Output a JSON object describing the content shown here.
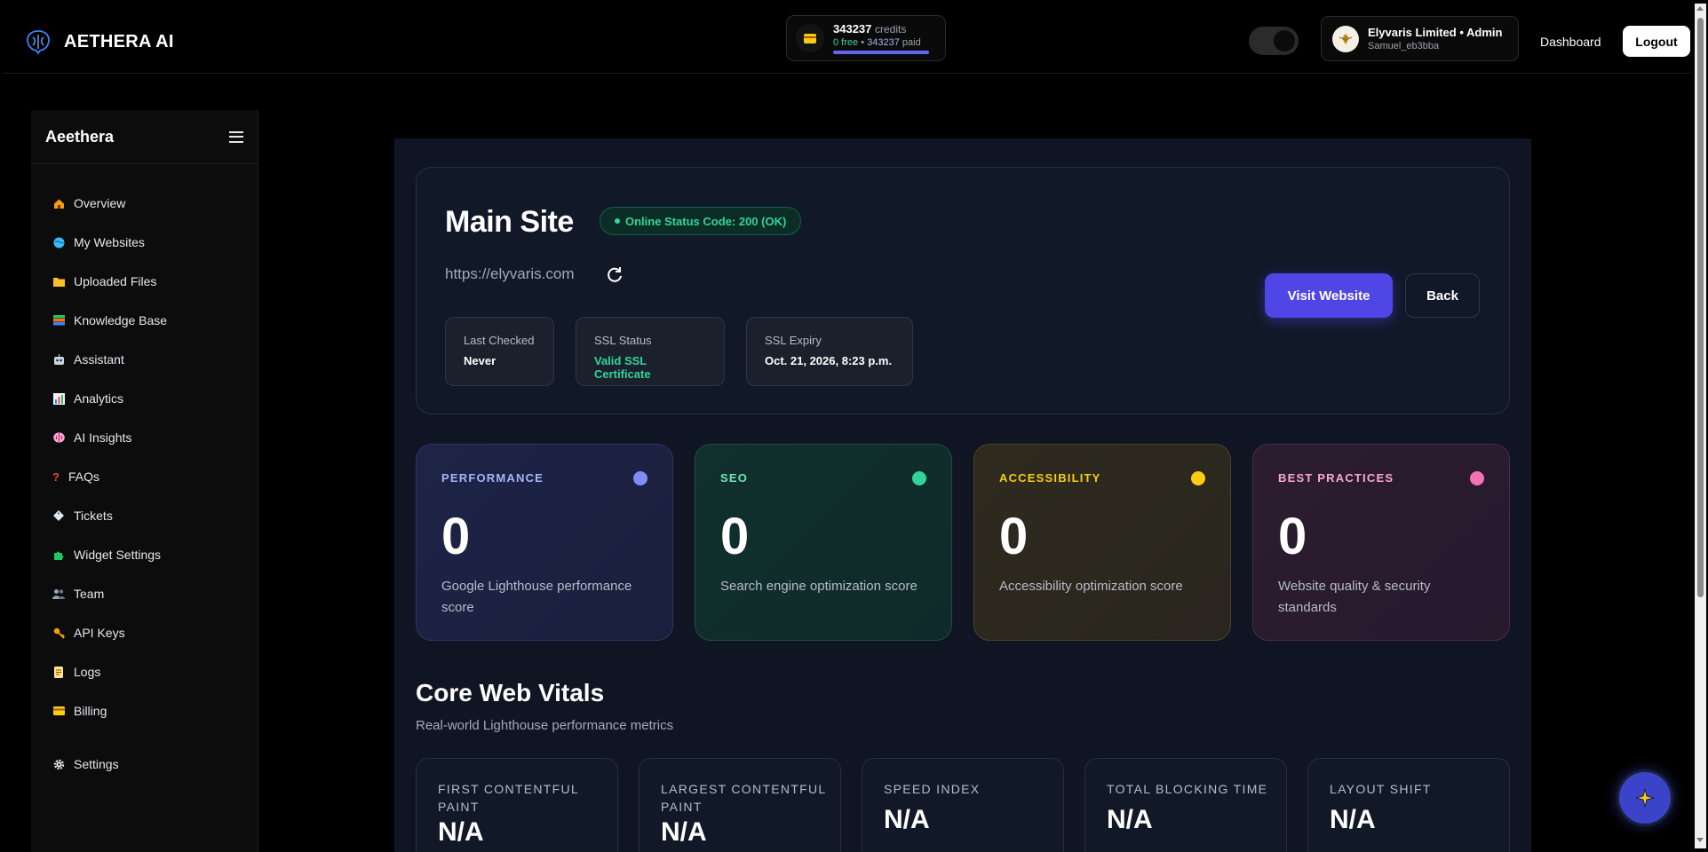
{
  "brand": {
    "name": "AETHERA AI"
  },
  "credits": {
    "total": "343237",
    "total_label": "credits",
    "free": "0 free",
    "sep": "•",
    "paid": "343237",
    "paid_label": "paid"
  },
  "account": {
    "name": "Elyvaris Limited • Admin",
    "username": "Samuel_eb3bba"
  },
  "nav": {
    "dashboard": "Dashboard",
    "logout": "Logout"
  },
  "sidebar": {
    "title": "Aeethera",
    "items": [
      {
        "label": "Overview",
        "icon": "home-icon"
      },
      {
        "label": "My Websites",
        "icon": "globe-icon"
      },
      {
        "label": "Uploaded Files",
        "icon": "folder-icon"
      },
      {
        "label": "Knowledge Base",
        "icon": "books-icon"
      },
      {
        "label": "Assistant",
        "icon": "robot-icon"
      },
      {
        "label": "Analytics",
        "icon": "bar-chart-icon"
      },
      {
        "label": "AI Insights",
        "icon": "brain-icon"
      },
      {
        "label": "FAQs",
        "icon": "question-icon"
      },
      {
        "label": "Tickets",
        "icon": "ticket-icon"
      },
      {
        "label": "Widget Settings",
        "icon": "puzzle-icon"
      },
      {
        "label": "Team",
        "icon": "users-icon"
      },
      {
        "label": "API Keys",
        "icon": "key-icon"
      },
      {
        "label": "Logs",
        "icon": "scroll-icon"
      },
      {
        "label": "Billing",
        "icon": "credit-card-icon"
      },
      {
        "label": "Settings",
        "icon": "gear-icon"
      }
    ]
  },
  "site": {
    "title": "Main Site",
    "status": "Online Status Code: 200 (OK)",
    "url": "https://elyvaris.com",
    "info": [
      {
        "label": "Last Checked",
        "value": "Never"
      },
      {
        "label": "SSL Status",
        "value": "Valid SSL Certificate"
      },
      {
        "label": "SSL Expiry",
        "value": "Oct. 21, 2026, 8:23 p.m."
      }
    ],
    "visit_label": "Visit Website",
    "back_label": "Back"
  },
  "scores": [
    {
      "label": "PERFORMANCE",
      "value": "0",
      "desc": "Google Lighthouse performance score",
      "color": "#818cf8"
    },
    {
      "label": "SEO",
      "value": "0",
      "desc": "Search engine optimization score",
      "color": "#34d399"
    },
    {
      "label": "ACCESSIBILITY",
      "value": "0",
      "desc": "Accessibility optimization score",
      "color": "#facc15"
    },
    {
      "label": "BEST PRACTICES",
      "value": "0",
      "desc": "Website quality & security standards",
      "color": "#f472b6"
    }
  ],
  "core_web_vitals": {
    "title": "Core Web Vitals",
    "subtitle": "Real-world Lighthouse performance metrics",
    "metrics": [
      {
        "label": "FIRST CONTENTFUL PAINT",
        "value": "N/A"
      },
      {
        "label": "LARGEST CONTENTFUL PAINT",
        "value": "N/A"
      },
      {
        "label": "SPEED INDEX",
        "value": "N/A"
      },
      {
        "label": "TOTAL BLOCKING TIME",
        "value": "N/A"
      },
      {
        "label": "LAYOUT SHIFT",
        "value": "N/A"
      }
    ]
  }
}
